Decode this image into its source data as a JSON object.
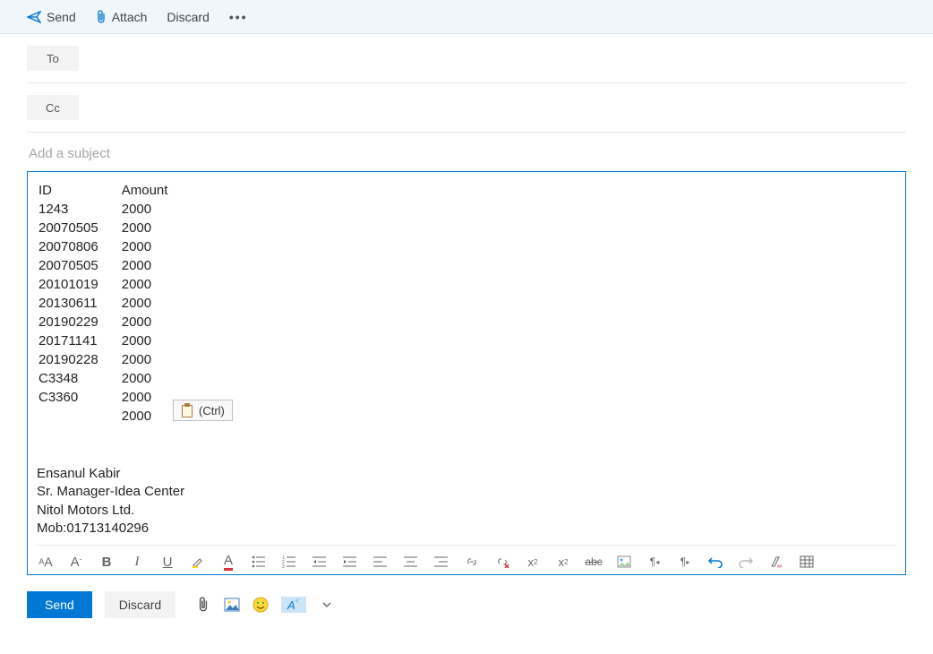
{
  "topbar": {
    "send": "Send",
    "attach": "Attach",
    "discard": "Discard"
  },
  "fields": {
    "to_label": "To",
    "cc_label": "Cc",
    "subject_placeholder": "Add a subject"
  },
  "table": {
    "headers": {
      "id": "ID",
      "amount": "Amount"
    },
    "rows": [
      {
        "id": "1243",
        "amount": "2000"
      },
      {
        "id": "20070505",
        "amount": "2000"
      },
      {
        "id": "20070806",
        "amount": "2000"
      },
      {
        "id": "20070505",
        "amount": "2000"
      },
      {
        "id": "20101019",
        "amount": "2000"
      },
      {
        "id": "20130611",
        "amount": "2000"
      },
      {
        "id": "20190229",
        "amount": "2000"
      },
      {
        "id": "20171141",
        "amount": "2000"
      },
      {
        "id": "20190228",
        "amount": "2000"
      },
      {
        "id": "C3348",
        "amount": "2000"
      },
      {
        "id": "C3360",
        "amount": "2000"
      },
      {
        "id": "",
        "amount": "2000"
      }
    ]
  },
  "paste_label": "(Ctrl)",
  "signature": {
    "name": "Ensanul Kabir",
    "title": "Sr. Manager-Idea Center",
    "company": "Nitol Motors Ltd.",
    "mobile": "Mob:01713140296"
  },
  "bottom": {
    "send": "Send",
    "discard": "Discard"
  }
}
